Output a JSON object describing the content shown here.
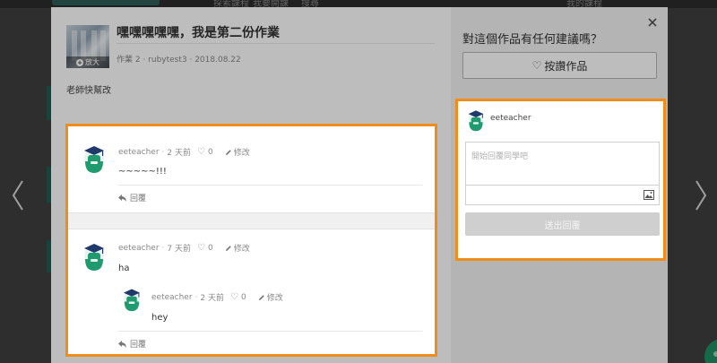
{
  "background": {
    "nav_items": [
      "探索課程",
      "我要開課",
      "搜尋",
      "我的課程"
    ]
  },
  "post": {
    "title": "嘿嘿嘿嘿嘿，我是第二份作業",
    "meta": "作業 2 · rubytest3 · 2018.08.22",
    "description": "老師快幫改",
    "thumbnail_zoom_label": "放大"
  },
  "comments": [
    {
      "author": "eeteacher",
      "time": "2 天前",
      "likes": "0",
      "edit_label": "修改",
      "body": "~~~~~!!!",
      "reply_label": "回覆"
    },
    {
      "author": "eeteacher",
      "time": "7 天前",
      "likes": "0",
      "edit_label": "修改",
      "body": "ha",
      "reply": {
        "author": "eeteacher",
        "time": "2 天前",
        "likes": "0",
        "edit_label": "修改",
        "body": "hey"
      },
      "reply_label": "回覆"
    }
  ],
  "sidebar": {
    "heading": "對這個作品有任何建議嗎？",
    "like_button": "按讚作品",
    "current_user": "eeteacher",
    "reply_placeholder": "開始回覆同學吧",
    "submit_label": "送出回覆"
  },
  "colors": {
    "highlight": "#f08c1a",
    "avatar_green": "#1f9b6f",
    "overlay": "#3f3f3f"
  }
}
